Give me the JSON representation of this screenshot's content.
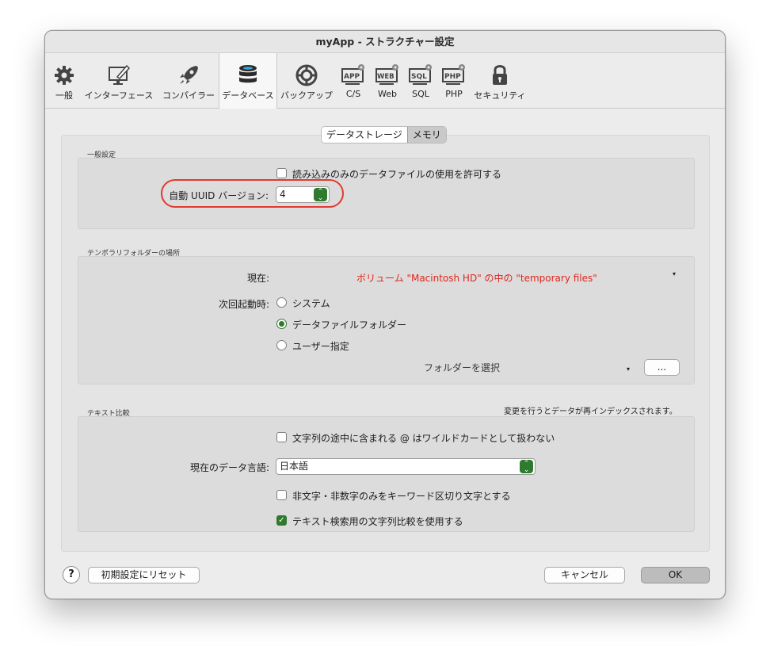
{
  "window": {
    "title": "myApp - ストラクチャー設定"
  },
  "toolbar": {
    "items": [
      {
        "label": "一般",
        "icon": "gear-icon"
      },
      {
        "label": "インターフェース",
        "icon": "monitor-pen-icon"
      },
      {
        "label": "コンパイラー",
        "icon": "rocket-icon"
      },
      {
        "label": "データベース",
        "icon": "database-icon",
        "active": true
      },
      {
        "label": "バックアップ",
        "icon": "lifebuoy-icon"
      },
      {
        "label": "C/S",
        "icon": "app-server-icon",
        "badge": "APP"
      },
      {
        "label": "Web",
        "icon": "web-server-icon",
        "badge": "WEB"
      },
      {
        "label": "SQL",
        "icon": "sql-server-icon",
        "badge": "SQL"
      },
      {
        "label": "PHP",
        "icon": "php-server-icon",
        "badge": "PHP"
      },
      {
        "label": "セキュリティ",
        "icon": "lock-icon"
      }
    ]
  },
  "tabs": {
    "storage": "データストレージ",
    "memory": "メモリ"
  },
  "general": {
    "section_title": "一般設定",
    "readonly_checkbox_label": "読み込みのみのデータファイルの使用を許可する",
    "uuid_label": "自動 UUID バージョン:",
    "uuid_value": "4"
  },
  "temp_folder": {
    "section_title": "テンポラリフォルダーの場所",
    "current_label": "現在:",
    "current_value": "ボリューム \"Macintosh HD\" の中の \"temporary files\"",
    "startup_label": "次回起動時:",
    "options": [
      "システム",
      "データファイルフォルダー",
      "ユーザー指定"
    ],
    "selected_option": "データファイルフォルダー",
    "choose_folder_label": "フォルダーを選択",
    "browse_button": "..."
  },
  "text_compare": {
    "section_title": "テキスト比較",
    "reindex_note": "変更を行うとデータが再インデックスされます。",
    "wildcard_checkbox_label": "文字列の途中に含まれる @ はワイルドカードとして扱わない",
    "language_label": "現在のデータ言語:",
    "language_value": "日本語",
    "nonalnum_checkbox_label": "非文字・非数字のみをキーワード区切り文字とする",
    "search_checkbox_label": "テキスト検索用の文字列比較を使用する",
    "search_checked": true
  },
  "footer": {
    "help": "?",
    "reset_button": "初期設定にリセット",
    "cancel_button": "キャンセル",
    "ok_button": "OK"
  },
  "colors": {
    "accent": "#2f7a2f",
    "highlight": "#e03a2f",
    "current_path": "#e0261d"
  }
}
